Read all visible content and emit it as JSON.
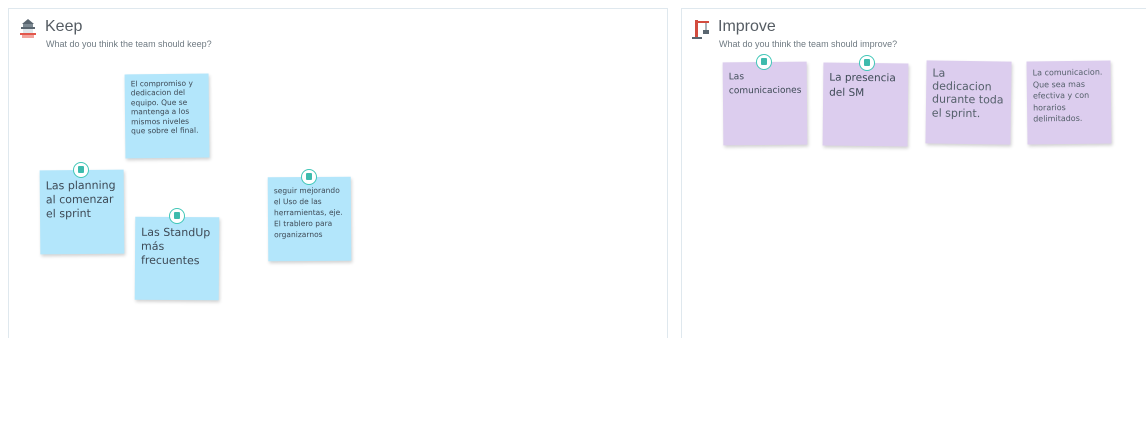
{
  "colors": {
    "note_blue": "#b3e6fb",
    "note_purple": "#dccdee",
    "badge_accent": "#42c7b8"
  },
  "keep": {
    "icon": "temple-icon",
    "title": "Keep",
    "subtitle": "What do you think the team should keep?",
    "notes": [
      {
        "text": "El compromiso y dedicacion del equipo. Que se mantenga a los mismos niveles que sobre el final."
      },
      {
        "text": "Las planning al comenzar el sprint"
      },
      {
        "text": "Las StandUp más frecuentes"
      },
      {
        "text": "seguir mejorando el Uso de las herramientas, eje. El trablero para organizarnos"
      }
    ]
  },
  "improve": {
    "icon": "crane-icon",
    "title": "Improve",
    "subtitle": "What do you think the team should improve?",
    "notes": [
      {
        "text": "Las comunicaciones"
      },
      {
        "text": "La presencia del SM"
      },
      {
        "text": "La dedicacion durante toda el sprint."
      },
      {
        "text": "La comunicacion. Que sea mas efectiva y con horarios delimitados."
      }
    ]
  }
}
